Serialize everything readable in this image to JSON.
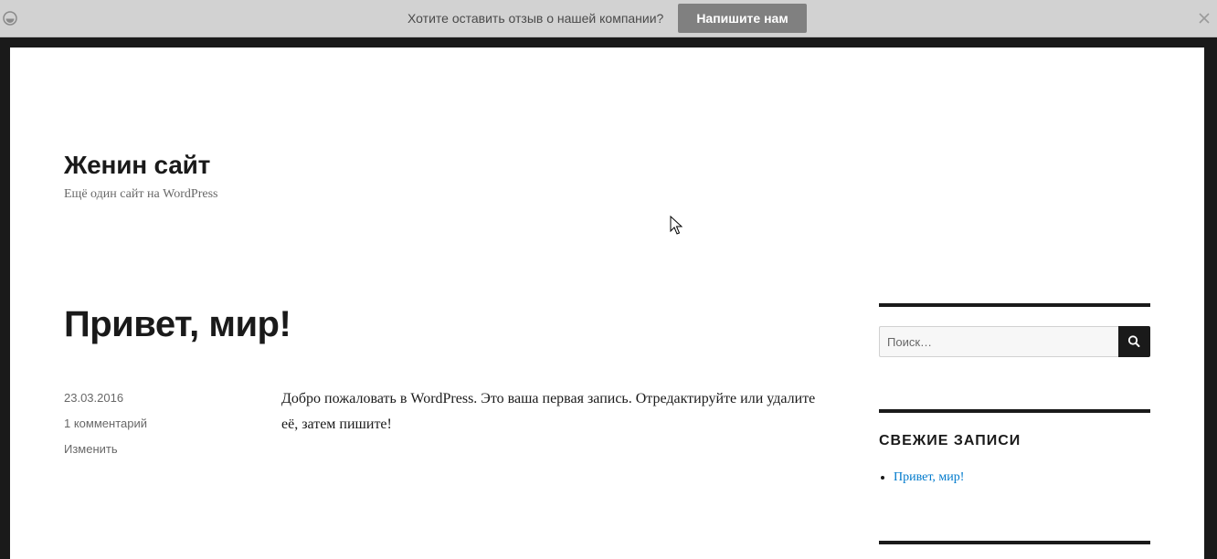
{
  "notice": {
    "text": "Хотите оставить отзыв о нашей компании?",
    "button_label": "Напишите нам",
    "logo_icon": "widget-logo-icon",
    "close_icon": "close-icon"
  },
  "site": {
    "title": "Женин сайт",
    "description": "Ещё один сайт на WordPress"
  },
  "post": {
    "title": "Привет, мир!",
    "date": "23.03.2016",
    "comments": "1 комментарий",
    "edit": "Изменить",
    "content": "Добро пожаловать в WordPress. Это ваша первая запись. Отредактируйте или удалите её, затем пишите!"
  },
  "sidebar": {
    "search": {
      "placeholder": "Поиск…",
      "value": "",
      "icon": "search-icon"
    },
    "recent_posts": {
      "title": "СВЕЖИЕ ЗАПИСИ",
      "items": [
        "Привет, мир!"
      ]
    }
  },
  "colors": {
    "notice_bg": "#d2d2d2",
    "notice_button": "#808080",
    "frame": "#1a1a1a",
    "link": "#007acc"
  }
}
